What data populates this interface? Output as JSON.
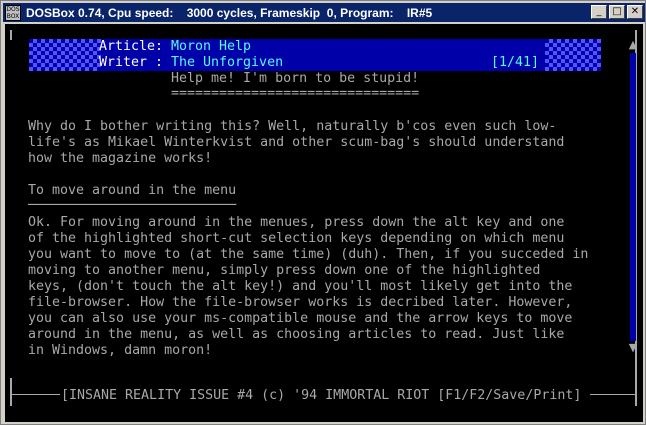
{
  "window": {
    "title": "DOSBox 0.74, Cpu speed:    3000 cycles, Frameskip  0, Program:    IR#5",
    "icon_text": "DOS BOX",
    "minimize": "_",
    "maximize": "□",
    "close": "✕"
  },
  "header": {
    "article_label": "Article:",
    "article_value": "Moron Help",
    "writer_label": "Writer :",
    "writer_value": "The Unforgiven",
    "page_counter": "[1/41]"
  },
  "content": {
    "heading": "Help me! I'm born to be stupid!",
    "heading_underline": "===============================",
    "para1": [
      "Why do I bother writing this? Well, naturally b'cos even such low-",
      "life's as Mikael Winterkvist and other scum-bag's should understand",
      "how the magazine works!"
    ],
    "section_title": "To move around in the menu",
    "section_rule": "──────────────────────────",
    "para2": [
      "Ok. For moving around in the menues, press down the alt key and one",
      "of the highlighted short-cut selection keys depending on which menu",
      "you want to move to (at the same time) (duh). Then, if you succeded in",
      "moving to another menu, simply press down one of the highlighted",
      "keys, (don't touch the alt key!) and you'll most likely get into the",
      "file-browser. How the file-browser works is decribed later. However,",
      "you can also use your ms-compatible mouse and the arrow keys to move",
      "around in the menu, as well as choosing articles to read. Just like",
      "in Windows, damn moron!"
    ]
  },
  "footer": {
    "text": "[INSANE REALITY ISSUE #4 (c) '94 IMMORTAL RIOT [F1/F2/Save/Print]"
  },
  "scrollbar": {
    "up": "▲",
    "down": "▼"
  }
}
